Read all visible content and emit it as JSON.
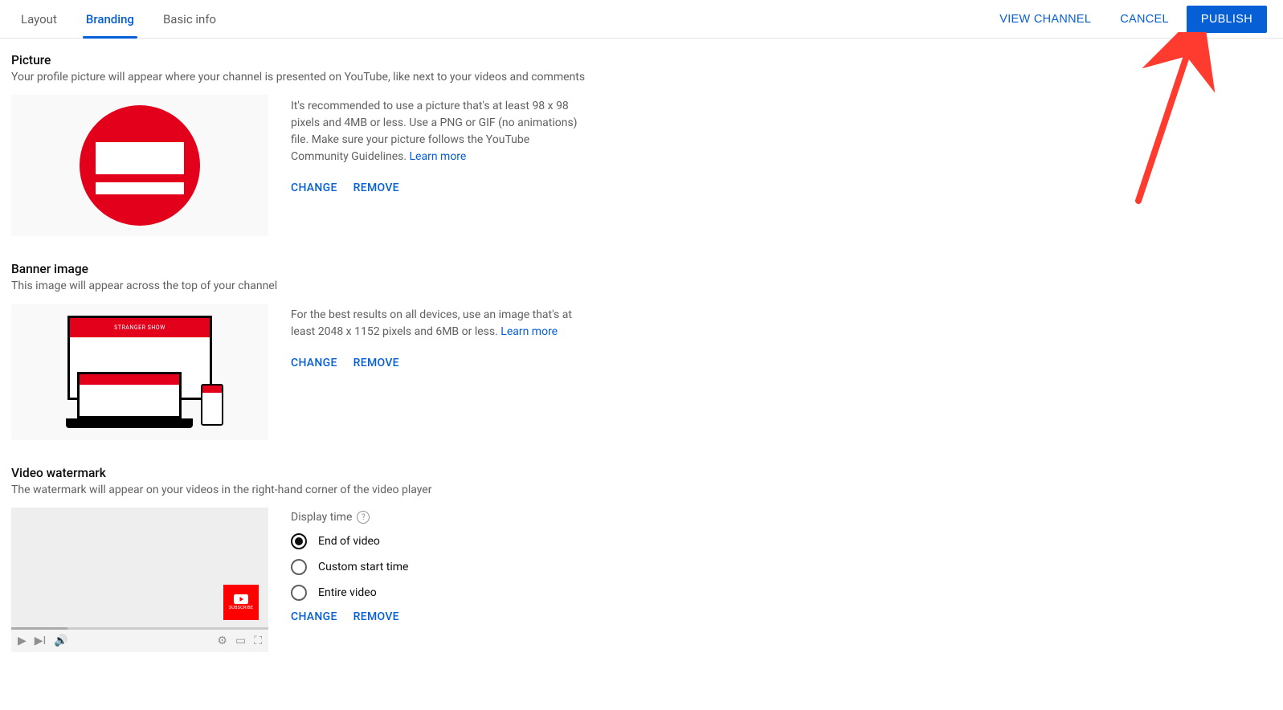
{
  "tabs": {
    "layout": "Layout",
    "branding": "Branding",
    "basic_info": "Basic info"
  },
  "actions": {
    "view_channel": "VIEW CHANNEL",
    "cancel": "CANCEL",
    "publish": "PUBLISH"
  },
  "picture": {
    "title": "Picture",
    "desc": "Your profile picture will appear where your channel is presented on YouTube, like next to your videos and comments",
    "guideline": "It's recommended to use a picture that's at least 98 x 98 pixels and 4MB or less. Use a PNG or GIF (no animations) file. Make sure your picture follows the YouTube Community Guidelines. ",
    "learn_more": "Learn more",
    "change": "CHANGE",
    "remove": "REMOVE"
  },
  "banner": {
    "title": "Banner image",
    "desc": "This image will appear across the top of your channel",
    "preview_label": "STRANGER SHOW",
    "guideline": "For the best results on all devices, use an image that's at least 2048 x 1152 pixels and 6MB or less. ",
    "learn_more": "Learn more",
    "change": "CHANGE",
    "remove": "REMOVE"
  },
  "watermark": {
    "title": "Video watermark",
    "desc": "The watermark will appear on your videos in the right-hand corner of the video player",
    "badge_label": "SUBSCRIBE",
    "display_time": "Display time",
    "options": {
      "end": "End of video",
      "custom": "Custom start time",
      "entire": "Entire video"
    },
    "change": "CHANGE",
    "remove": "REMOVE"
  }
}
